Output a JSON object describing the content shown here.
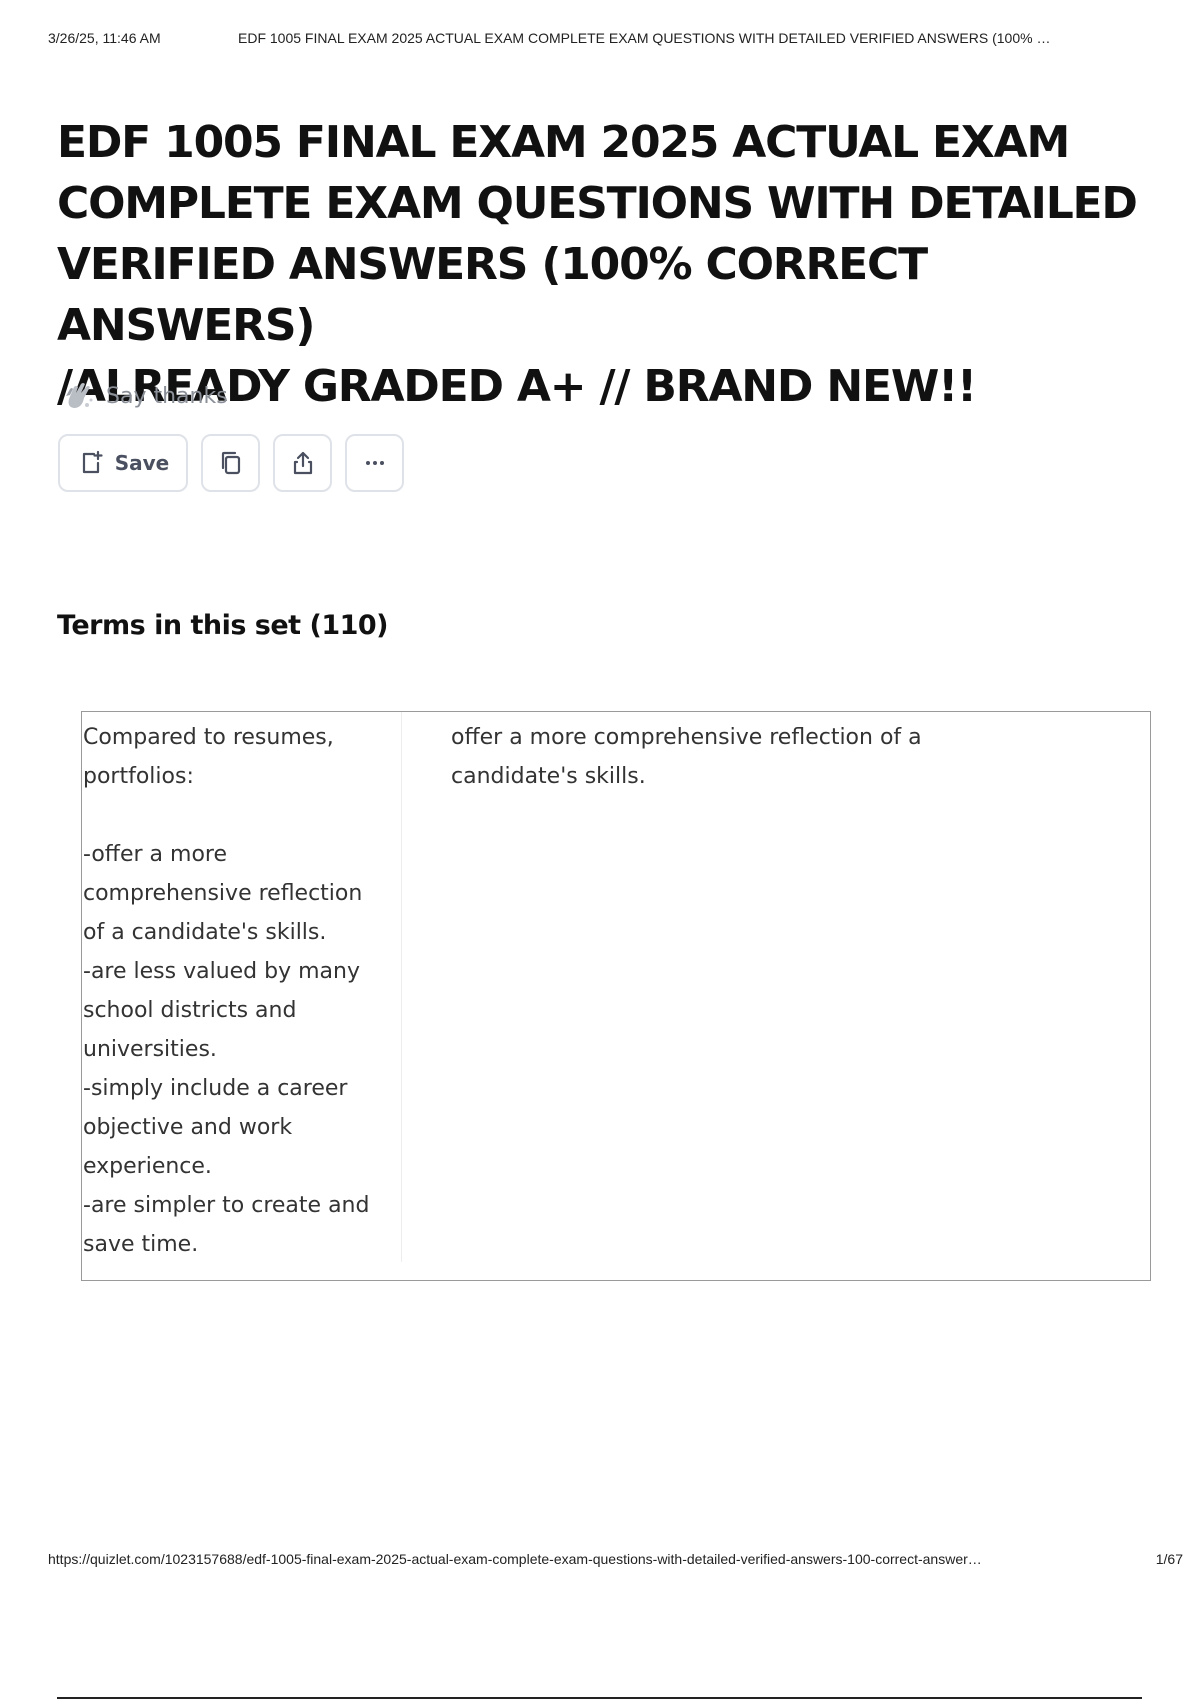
{
  "print_header": {
    "datetime": "3/26/25, 11:46 AM",
    "title": "EDF 1005 FINAL EXAM 2025 ACTUAL EXAM COMPLETE EXAM QUESTIONS WITH DETAILED VERIFIED ANSWERS (100% …"
  },
  "page": {
    "title_lines": [
      "EDF 1005 FINAL EXAM 2025 ACTUAL EXAM",
      "COMPLETE EXAM QUESTIONS WITH DETAILED",
      "VERIFIED ANSWERS (100% CORRECT ANSWERS)",
      "/ALREADY GRADED A+  // BRAND NEW!!"
    ],
    "say_thanks": "Say thanks"
  },
  "toolbar": {
    "save_label": "Save",
    "icons": [
      "save-icon",
      "copy-icon",
      "share-icon",
      "more-icon"
    ]
  },
  "terms_section": {
    "title": "Terms in this set (110)",
    "cards": [
      {
        "term": "Compared to resumes,\nportfolios:\n\n-offer a more\ncomprehensive reflection\nof a candidate's skills.\n-are less valued by many\nschool districts and\nuniversities.\n-simply include a career\nobjective and work\nexperience.\n-are simpler to create and\nsave time.",
        "definition": "offer a more comprehensive reflection of a candidate's skills."
      }
    ]
  },
  "print_footer": {
    "url": "https://quizlet.com/1023157688/edf-1005-final-exam-2025-actual-exam-complete-exam-questions-with-detailed-verified-answers-100-correct-answer…",
    "page_number": "1/67"
  },
  "colors": {
    "title": "#111111",
    "muted": "#8a8f98",
    "button_border": "#dfe2e8",
    "card_border": "#9a9a9a"
  }
}
